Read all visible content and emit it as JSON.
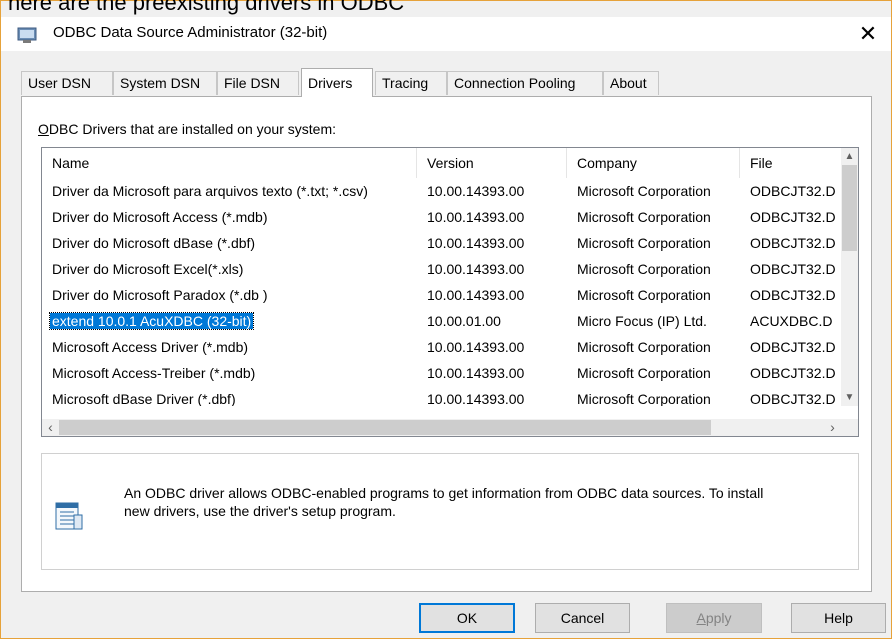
{
  "overlay_text": "here are the preexisting drivers in ODBC",
  "window": {
    "title": "ODBC Data Source Administrator (32-bit)",
    "close_label": "✕"
  },
  "tabs": [
    {
      "label": "User DSN",
      "active": false
    },
    {
      "label": "System DSN",
      "active": false
    },
    {
      "label": "File DSN",
      "active": false
    },
    {
      "label": "Drivers",
      "active": true
    },
    {
      "label": "Tracing",
      "active": false
    },
    {
      "label": "Connection Pooling",
      "active": false
    },
    {
      "label": "About",
      "active": false
    }
  ],
  "drivers": {
    "caption_accel": "O",
    "caption_rest": "DBC Drivers that are installed on your system:",
    "columns": {
      "name": "Name",
      "version": "Version",
      "company": "Company",
      "file": "File"
    },
    "rows": [
      {
        "name": "Driver da Microsoft para arquivos texto (*.txt; *.csv)",
        "version": "10.00.14393.00",
        "company": "Microsoft Corporation",
        "file": "ODBCJT32.D"
      },
      {
        "name": "Driver do Microsoft Access (*.mdb)",
        "version": "10.00.14393.00",
        "company": "Microsoft Corporation",
        "file": "ODBCJT32.D"
      },
      {
        "name": "Driver do Microsoft dBase (*.dbf)",
        "version": "10.00.14393.00",
        "company": "Microsoft Corporation",
        "file": "ODBCJT32.D"
      },
      {
        "name": "Driver do Microsoft Excel(*.xls)",
        "version": "10.00.14393.00",
        "company": "Microsoft Corporation",
        "file": "ODBCJT32.D"
      },
      {
        "name": "Driver do Microsoft Paradox (*.db )",
        "version": "10.00.14393.00",
        "company": "Microsoft Corporation",
        "file": "ODBCJT32.D"
      },
      {
        "name": "extend 10.0.1 AcuXDBC (32-bit)",
        "version": "10.00.01.00",
        "company": "Micro Focus (IP) Ltd.",
        "file": "ACUXDBC.D",
        "selected": true
      },
      {
        "name": "Microsoft Access Driver (*.mdb)",
        "version": "10.00.14393.00",
        "company": "Microsoft Corporation",
        "file": "ODBCJT32.D"
      },
      {
        "name": "Microsoft Access-Treiber (*.mdb)",
        "version": "10.00.14393.00",
        "company": "Microsoft Corporation",
        "file": "ODBCJT32.D"
      },
      {
        "name": "Microsoft dBase Driver (*.dbf)",
        "version": "10.00.14393.00",
        "company": "Microsoft Corporation",
        "file": "ODBCJT32.D"
      }
    ]
  },
  "info": {
    "line1": "An ODBC driver allows ODBC-enabled programs to get information from ODBC data sources.  To install",
    "line2": "new drivers, use the driver's setup program."
  },
  "buttons": {
    "ok": "OK",
    "cancel": "Cancel",
    "apply_accel": "A",
    "apply_rest": "pply",
    "help": "Help"
  }
}
